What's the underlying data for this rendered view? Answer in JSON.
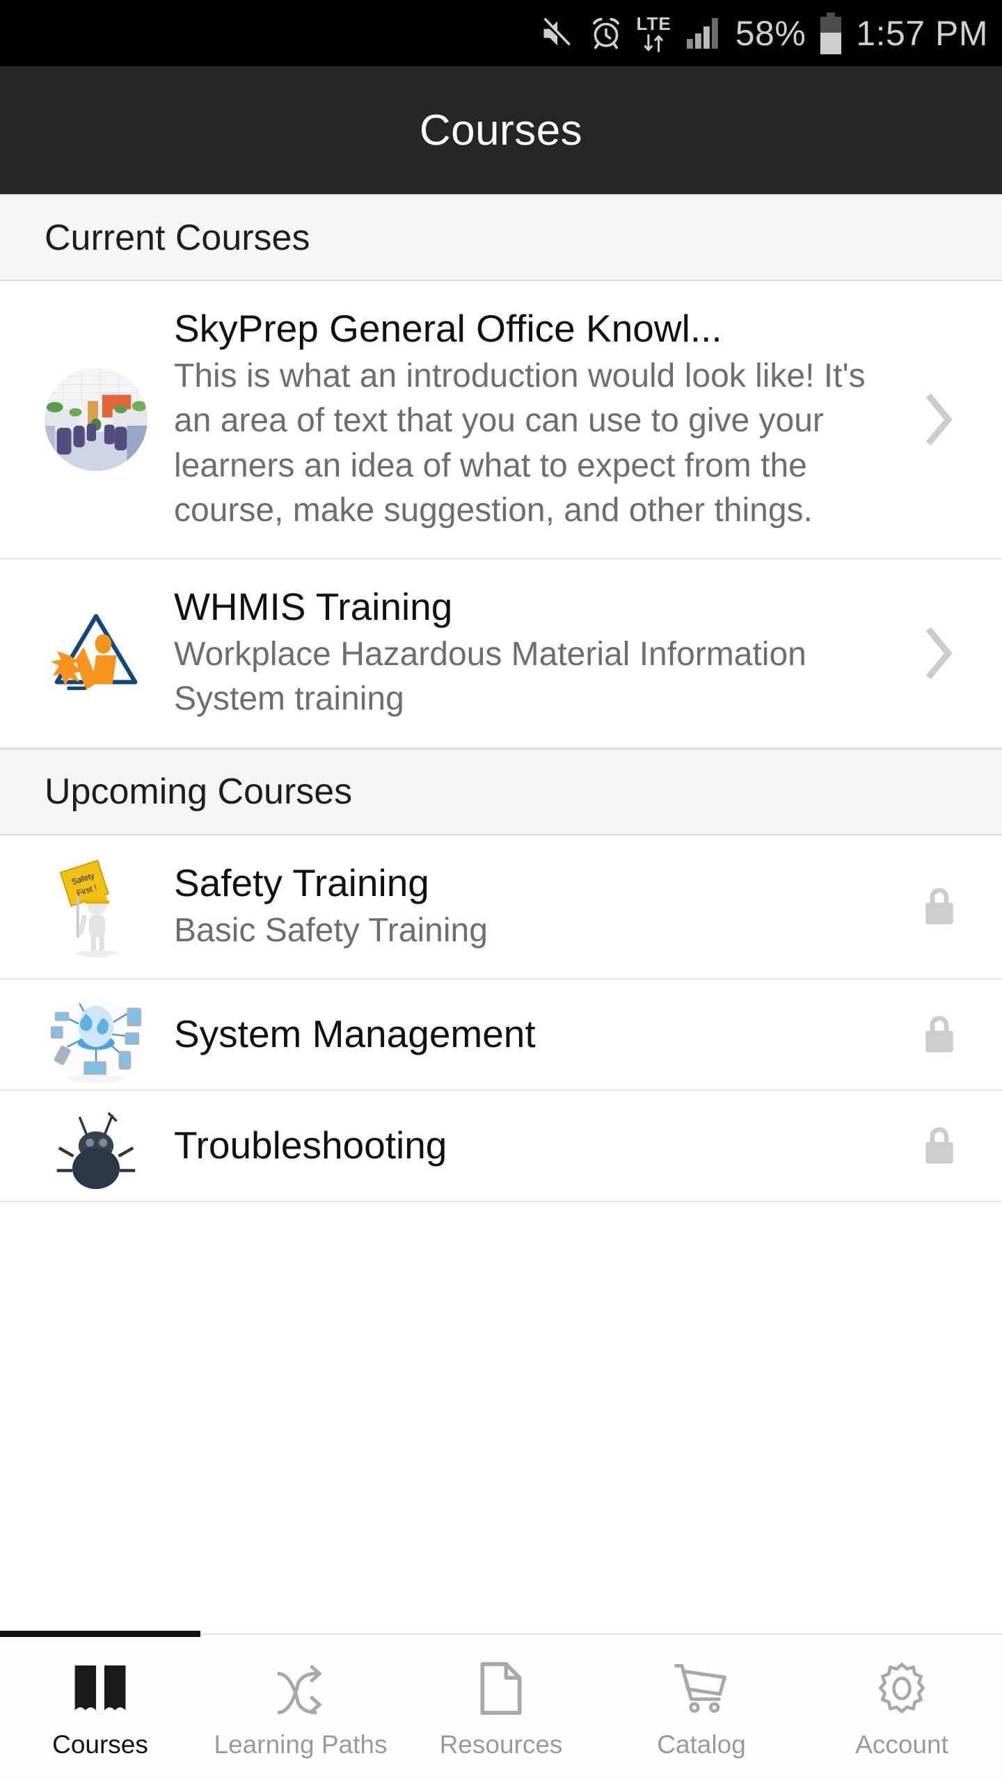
{
  "status_bar": {
    "icons": [
      "mute-icon",
      "alarm-icon",
      "lte-icon",
      "signal-icon"
    ],
    "network_label": "LTE",
    "battery_percent": "58%",
    "time": "1:57 PM"
  },
  "header": {
    "title": "Courses"
  },
  "sections": [
    {
      "id": "current-courses",
      "label": "Current Courses",
      "courses": [
        {
          "title": "SkyPrep General Office Knowl...",
          "description": "This is what an introduction would look like! It's an area of text that you can use to give your learners an idea of what to expect from the course, make suggestion, and other things.",
          "thumbnail": "office-interior-photo",
          "affordance": "chevron-right-icon",
          "locked": false
        },
        {
          "title": "WHMIS Training",
          "description": "Workplace Hazardous Material Information System training",
          "thumbnail": "whmis-triangle-logo",
          "affordance": "chevron-right-icon",
          "locked": false
        }
      ]
    },
    {
      "id": "upcoming-courses",
      "label": "Upcoming Courses",
      "courses": [
        {
          "title": "Safety Training",
          "description": "Basic Safety Training",
          "thumbnail": "safety-first-figure",
          "affordance": "lock-icon",
          "locked": true
        },
        {
          "title": "System Management",
          "description": "",
          "thumbnail": "network-globe-graphic",
          "affordance": "lock-icon",
          "locked": true
        },
        {
          "title": "Troubleshooting",
          "description": "",
          "thumbnail": "bug-graphic",
          "affordance": "lock-icon",
          "locked": true
        }
      ]
    }
  ],
  "tabbar": {
    "active_index": 0,
    "tabs": [
      {
        "label": "Courses",
        "icon": "book-icon"
      },
      {
        "label": "Learning Paths",
        "icon": "shuffle-icon"
      },
      {
        "label": "Resources",
        "icon": "document-icon"
      },
      {
        "label": "Catalog",
        "icon": "shopping-cart-icon"
      },
      {
        "label": "Account",
        "icon": "gear-icon"
      }
    ]
  },
  "colors": {
    "status_bar_bg": "#000000",
    "app_bar_bg": "#262626",
    "section_bg": "#f5f5f5",
    "title_text": "#111111",
    "desc_text": "#6e6e6e",
    "muted_icon": "#cccccc",
    "tab_inactive": "#9a9a9a",
    "whmis_blue": "#12467f",
    "whmis_orange": "#f7941e",
    "safety_yellow": "#f2c012"
  }
}
